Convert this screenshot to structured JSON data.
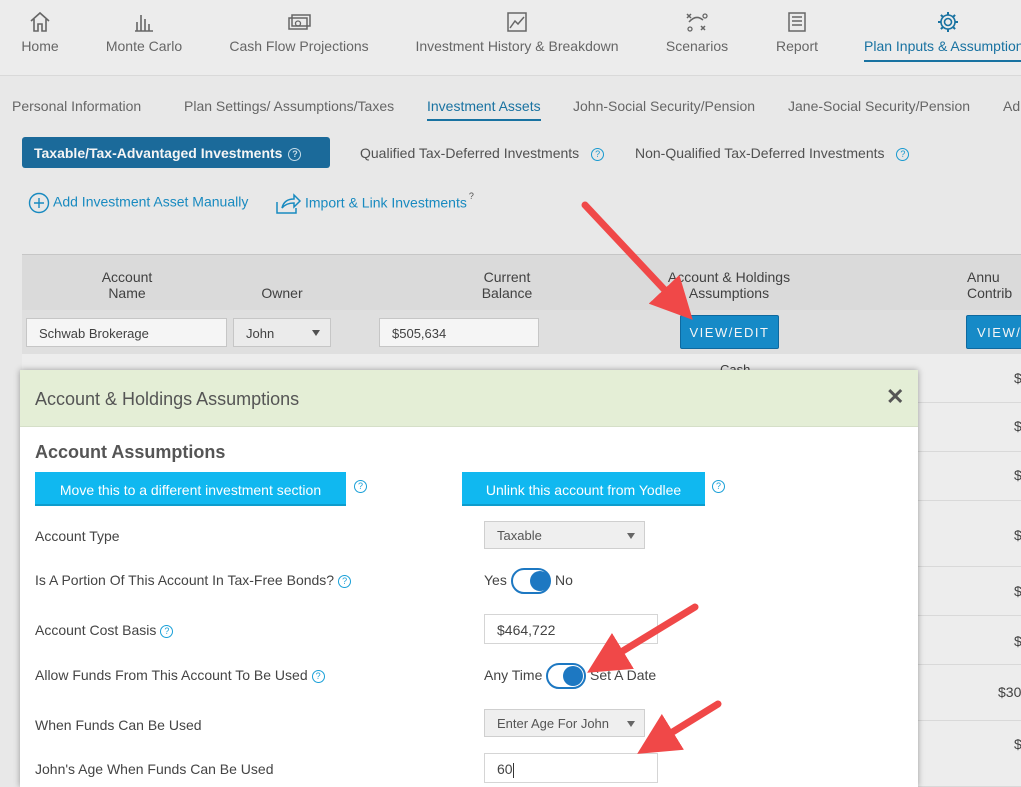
{
  "topnav": [
    {
      "label": "Home",
      "icon": "home-icon"
    },
    {
      "label": "Monte Carlo",
      "icon": "bar-chart-icon"
    },
    {
      "label": "Cash Flow Projections",
      "icon": "money-icon"
    },
    {
      "label": "Investment History & Breakdown",
      "icon": "line-chart-icon"
    },
    {
      "label": "Scenarios",
      "icon": "scenario-icon"
    },
    {
      "label": "Report",
      "icon": "report-icon"
    },
    {
      "label": "Plan Inputs & Assumptions",
      "icon": "gear-icon",
      "active": true
    }
  ],
  "subtabs": [
    "Personal Information",
    "Plan Settings/ Assumptions/Taxes",
    "Investment Assets",
    "John-Social Security/Pension",
    "Jane-Social Security/Pension",
    "Ad"
  ],
  "active_subtab": "Investment Assets",
  "section_tabs": {
    "active": "Taxable/Tax-Advantaged Investments",
    "qualified": "Qualified Tax-Deferred Investments",
    "nonqualified": "Non-Qualified Tax-Deferred Investments"
  },
  "actions": {
    "add_manual": "Add Investment Asset Manually",
    "import_link": "Import & Link Investments"
  },
  "table": {
    "headers": {
      "account_name": "Account\nName",
      "owner": "Owner",
      "current_balance": "Current\nBalance",
      "holdings": "Account & Holdings\nAssumptions",
      "annual_contrib": "Annu\nContrib"
    },
    "row1": {
      "account_name": "Schwab Brokerage",
      "owner": "John",
      "balance": "$505,634",
      "view_edit": "VIEW/EDIT",
      "view_edit2": "VIEW/E"
    },
    "partial_cash": "Cash",
    "right_values": [
      "$",
      "$",
      "$",
      "$",
      "$",
      "$",
      "$30",
      "$"
    ]
  },
  "modal": {
    "title": "Account & Holdings Assumptions",
    "close": "✕",
    "section_title": "Account Assumptions",
    "move_button": "Move this to a different investment section",
    "unlink_button": "Unlink this account from Yodlee",
    "help_glyph": "?",
    "fields": {
      "account_type_label": "Account Type",
      "account_type_value": "Taxable",
      "tax_free_label": "Is A Portion Of This Account In Tax-Free Bonds?",
      "tax_free_yes": "Yes",
      "tax_free_no": "No",
      "cost_basis_label": "Account Cost Basis",
      "cost_basis_value": "$464,722",
      "allow_funds_label": "Allow Funds From This Account To Be Used",
      "allow_funds_anytime": "Any Time",
      "allow_funds_setdate": "Set A Date",
      "when_funds_label": "When Funds Can Be Used",
      "when_funds_value": "Enter Age For John",
      "johns_age_label": "John's Age When Funds Can Be Used",
      "johns_age_value": "60"
    }
  },
  "colors": {
    "brand_blue": "#1d6fa1",
    "link_blue": "#1a90c8",
    "cyan_button": "#10b8f0",
    "modal_header": "#e4eed6",
    "arrow_red": "#f04848"
  }
}
